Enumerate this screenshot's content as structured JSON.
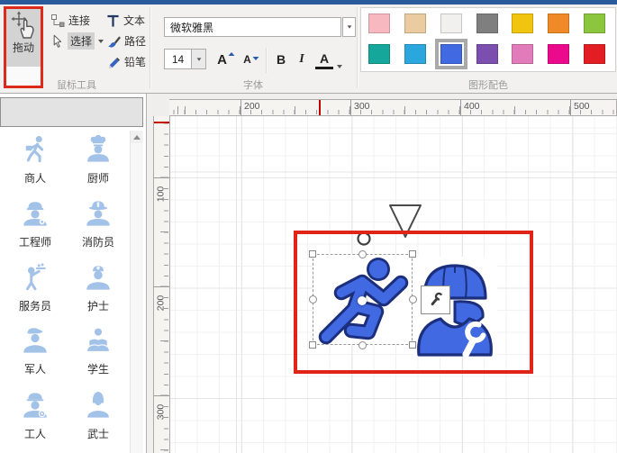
{
  "ribbon": {
    "mouse_tools": {
      "group_label": "鼠标工具",
      "drag_label": "拖动",
      "connect_label": "连接",
      "select_label": "选择",
      "text_label": "文本",
      "path_label": "路径",
      "pencil_label": "铅笔"
    },
    "font": {
      "group_label": "字体",
      "font_name": "微软雅黑",
      "font_size": "14",
      "grow_label": "A",
      "shrink_label": "A",
      "bold_label": "B",
      "italic_label": "I",
      "color_label": "A"
    },
    "palette": {
      "group_label": "图形配色",
      "selected_color_name": "royal-blue",
      "colors": [
        {
          "name": "pink",
          "hex": "#F8B8BF"
        },
        {
          "name": "tan",
          "hex": "#EACCA0"
        },
        {
          "name": "white",
          "hex": "#F2F0EF"
        },
        {
          "name": "gray",
          "hex": "#7F7F7F"
        },
        {
          "name": "gold",
          "hex": "#F1C40F"
        },
        {
          "name": "orange",
          "hex": "#F08A28"
        },
        {
          "name": "green",
          "hex": "#8CC63F"
        },
        {
          "name": "teal",
          "hex": "#14A79A"
        },
        {
          "name": "sky-blue",
          "hex": "#2BA7DE"
        },
        {
          "name": "royal-blue",
          "hex": "#4169E1"
        },
        {
          "name": "purple",
          "hex": "#7C4FAE"
        },
        {
          "name": "orchid",
          "hex": "#E17BBA"
        },
        {
          "name": "magenta",
          "hex": "#EB0A8C"
        },
        {
          "name": "red",
          "hex": "#E21E24"
        }
      ]
    }
  },
  "sidebar": {
    "items": [
      {
        "label": "商人",
        "icon": "businessman-icon"
      },
      {
        "label": "厨师",
        "icon": "chef-icon"
      },
      {
        "label": "工程师",
        "icon": "engineer-icon"
      },
      {
        "label": "消防员",
        "icon": "firefighter-icon"
      },
      {
        "label": "服务员",
        "icon": "waiter-icon"
      },
      {
        "label": "护士",
        "icon": "nurse-icon"
      },
      {
        "label": "军人",
        "icon": "soldier-icon"
      },
      {
        "label": "学生",
        "icon": "student-icon"
      },
      {
        "label": "工人",
        "icon": "worker-icon"
      },
      {
        "label": "武士",
        "icon": "warrior-icon"
      }
    ]
  },
  "rulers": {
    "horizontal": [
      "200",
      "300",
      "400",
      "500"
    ],
    "vertical": [
      "100",
      "200",
      "300"
    ]
  },
  "canvas": {
    "shape_fill_color": "#4169E1",
    "shape_outline_color": "#1B2F7D",
    "annotation_color": "#E02418"
  }
}
